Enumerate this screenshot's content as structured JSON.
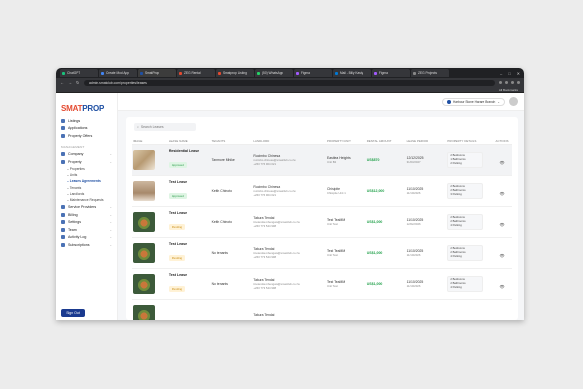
{
  "browser": {
    "tabs": [
      {
        "label": "ChatGPT",
        "color": "#19c37d"
      },
      {
        "label": "Create Mod App",
        "color": "#4285f4"
      },
      {
        "label": "SmatProp",
        "color": "#1e4fa3",
        "active": true
      },
      {
        "label": "ZEG Rental",
        "color": "#e44a30"
      },
      {
        "label": "Smatprop Listing",
        "color": "#e44a30"
      },
      {
        "label": "(50) WhatsApp",
        "color": "#25d366"
      },
      {
        "label": "Figma",
        "color": "#a259ff"
      },
      {
        "label": "Mail - Billy Kasty",
        "color": "#0078d4"
      },
      {
        "label": "Figma",
        "color": "#a259ff"
      },
      {
        "label": "ZEG Projects",
        "color": "#888888"
      }
    ],
    "url": "admin.smatclub.com/properties/leases",
    "bookmarks_label": "All Bookmarks"
  },
  "sidebar": {
    "logo_a": "SMAT",
    "logo_b": "PROP",
    "items_top": [
      {
        "label": "Listings"
      },
      {
        "label": "Applications"
      },
      {
        "label": "Property Offers"
      }
    ],
    "section_label": "MANAGEMENT",
    "items_mgmt": [
      {
        "label": "Company"
      },
      {
        "label": "Property"
      }
    ],
    "subitems": [
      {
        "label": "Properties"
      },
      {
        "label": "Units"
      },
      {
        "label": "Leases Agreements",
        "active": true
      },
      {
        "label": "Tenants"
      },
      {
        "label": "Landlords"
      },
      {
        "label": "Maintenance Requests"
      }
    ],
    "items_bottom": [
      {
        "label": "Service Providers"
      },
      {
        "label": "Billing"
      },
      {
        "label": "Settings"
      },
      {
        "label": "Team"
      },
      {
        "label": "Activity Log"
      },
      {
        "label": "Subscriptions"
      }
    ],
    "signout_label": "Sign Out"
  },
  "topbar": {
    "branch_label": "Harbour Stone Harare Branch"
  },
  "search": {
    "placeholder": "Search Leases"
  },
  "table": {
    "headers": [
      "IMAGE",
      "LEASE NAME",
      "TENANTS",
      "LANDLORD",
      "PROPERTY/UNIT",
      "RENTAL AMOUNT",
      "LEASE PERIOD",
      "PROPERTY DETAILS",
      "ACTIONS"
    ],
    "rows": [
      {
        "img": "a",
        "lease_name": "Residential Lease",
        "status": "Approved",
        "status_type": "ok",
        "tenant": "Tanmore Mhike",
        "landlord": "Rucimbo Chinesa",
        "landlord_email": "rucimbo.chinesa@smatclub.co.zw",
        "landlord_phone": "+263 776 904 021",
        "property": "Eastlea Heights",
        "unit": "Unit B2",
        "rent": "US$870",
        "start": "12/12/2025",
        "end": "31/03/2027",
        "beds": "2 Bedrooms",
        "baths": "1 Bathrooms",
        "parking": "2 Parking",
        "highlight": true
      },
      {
        "img": "b",
        "lease_name": "Test Lease",
        "status": "Approved",
        "status_type": "ok",
        "tenant": "Keith Chinoto",
        "landlord": "Rucimbo Chinesa",
        "landlord_email": "rucimbo.chinesa@smatclub.co.zw",
        "landlord_phone": "+263 776 904 021",
        "property": "Chisipite",
        "unit": "Chisipite Unit 1",
        "rent": "US$12,000",
        "start": "11/10/2025",
        "end": "11/10/2026",
        "beds": "2 Bedrooms",
        "baths": "2 Bathrooms",
        "parking": "3 Parking",
        "highlight": false
      },
      {
        "img": "c",
        "lease_name": "Test Lease",
        "status": "Pending",
        "status_type": "pend",
        "tenant": "Keith Chinoto",
        "landlord": "Takura Tendai",
        "landlord_email": "tinotenda.mbengwa@smatclub.co.zw",
        "landlord_phone": "+263 773 544 998",
        "property": "Test TeaMM",
        "unit": "Unit Test",
        "rent": "US$1,000",
        "start": "11/10/2025",
        "end": "12/02/2026",
        "beds": "2 Bedrooms",
        "baths": "2 Bathrooms",
        "parking": "4 Parking",
        "highlight": false
      },
      {
        "img": "c",
        "lease_name": "Test Lease",
        "status": "Pending",
        "status_type": "pend",
        "tenant": "No tenants",
        "landlord": "Takura Tendai",
        "landlord_email": "tinotenda.mbengwa@smatclub.co.zw",
        "landlord_phone": "+263 773 544 998",
        "property": "Test TeaMM",
        "unit": "Unit Test",
        "rent": "US$1,000",
        "start": "11/10/2025",
        "end": "11/10/2026",
        "beds": "2 Bedrooms",
        "baths": "2 Bathrooms",
        "parking": "4 Parking",
        "highlight": false
      },
      {
        "img": "c",
        "lease_name": "Test Lease",
        "status": "Pending",
        "status_type": "pend",
        "tenant": "No tenants",
        "landlord": "Takura Tendai",
        "landlord_email": "tinotenda.mbengwa@smatclub.co.zw",
        "landlord_phone": "+263 773 544 998",
        "property": "Test TeaMM",
        "unit": "Unit Test",
        "rent": "US$1,000",
        "start": "11/10/2025",
        "end": "11/10/2026",
        "beds": "2 Bedrooms",
        "baths": "2 Bathrooms",
        "parking": "4 Parking",
        "highlight": false
      },
      {
        "img": "c",
        "lease_name": "",
        "status": "",
        "status_type": "none",
        "tenant": "",
        "landlord": "Takura Tendai",
        "landlord_email": "",
        "landlord_phone": "",
        "property": "",
        "unit": "",
        "rent": "",
        "start": "",
        "end": "",
        "beds": "",
        "baths": "",
        "parking": "",
        "highlight": false
      }
    ]
  }
}
